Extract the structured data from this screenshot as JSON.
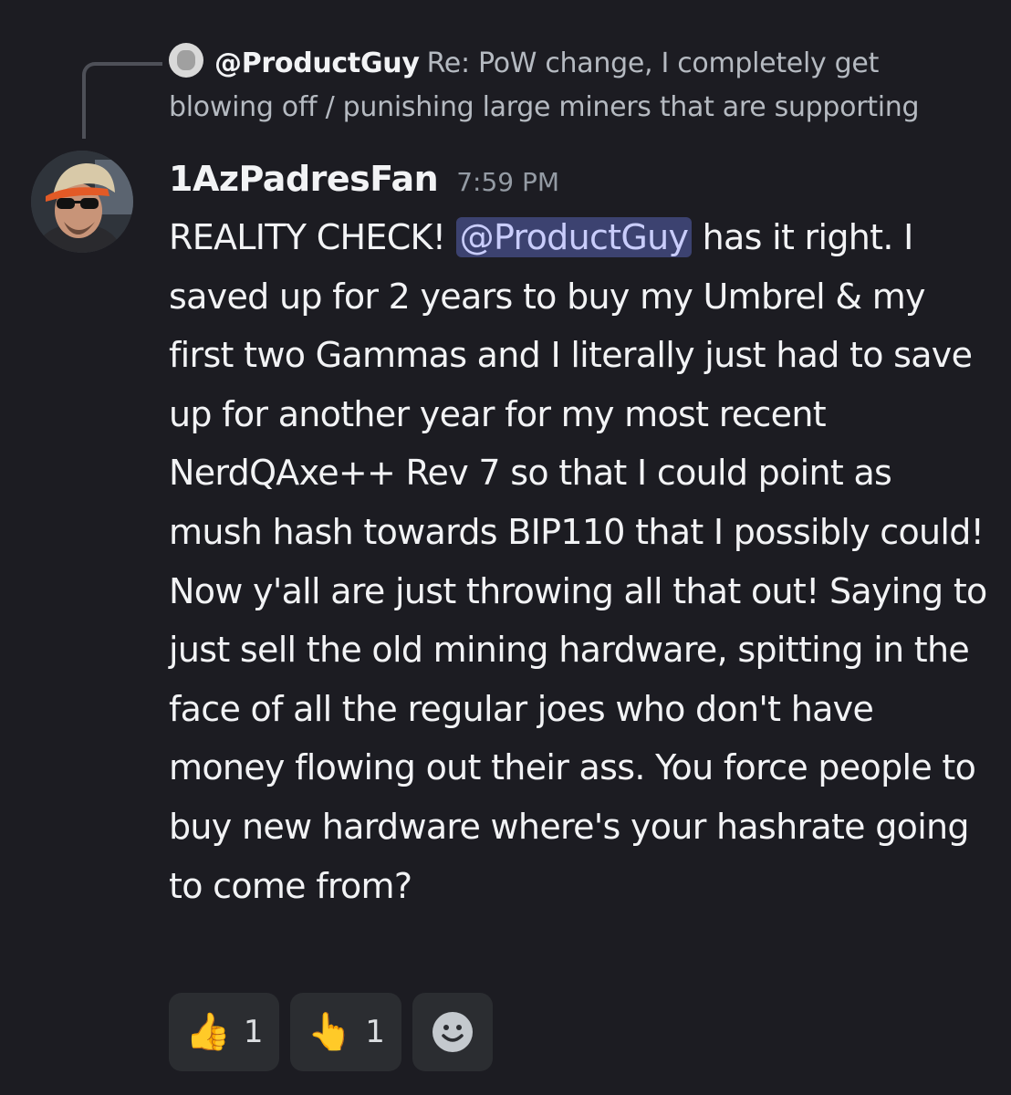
{
  "reply": {
    "author": "@ProductGuy",
    "text": "Re: PoW change, I completely get blowing off / punishing large miners that are supporting"
  },
  "message": {
    "author": "1AzPadresFan",
    "timestamp": "7:59 PM",
    "text_before_mention": "REALITY CHECK! ",
    "mention": "@ProductGuy",
    "text_after_mention": "  has it right. I saved up for 2 years to buy my Umbrel  & my first two Gammas and I literally just had to save up for another year for my most recent NerdQAxe++ Rev 7 so that I could point as mush hash towards BIP110 that I possibly could! Now y'all are just throwing all that out! Saying to just sell the old mining hardware, spitting in the face of all the regular joes who don't have money flowing out their ass. You force people to buy new hardware where's your hashrate going to come from?"
  },
  "reactions": [
    {
      "emoji": "👍",
      "icon": "thumbs-up-icon",
      "count": "1"
    },
    {
      "emoji": "👆",
      "icon": "point-up-icon",
      "count": "1"
    }
  ],
  "add_reaction_icon": "add-reaction-smiley-icon",
  "colors": {
    "background": "#1c1c22",
    "mention_bg": "#3c4270",
    "mention_text": "#c9cdfb",
    "reaction_bg": "#2b2d31"
  }
}
